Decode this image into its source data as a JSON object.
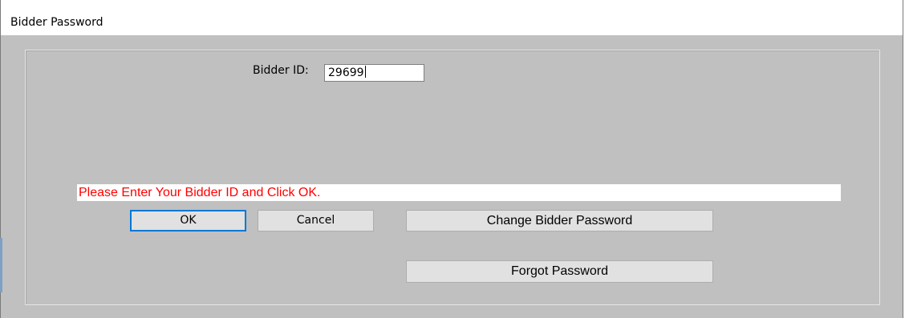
{
  "window": {
    "title": "Bidder Password"
  },
  "form": {
    "bidder_id_label": "Bidder ID:",
    "bidder_id_value": "29699"
  },
  "message": {
    "text": "Please Enter Your Bidder ID and Click OK.",
    "color": "#ff0000"
  },
  "buttons": {
    "ok": "OK",
    "cancel": "Cancel",
    "change_password": "Change Bidder Password",
    "forgot_password": "Forgot Password"
  },
  "colors": {
    "dialog_background": "#c0c0c0",
    "focus_border": "#0078d7",
    "button_face": "#e1e1e1"
  }
}
